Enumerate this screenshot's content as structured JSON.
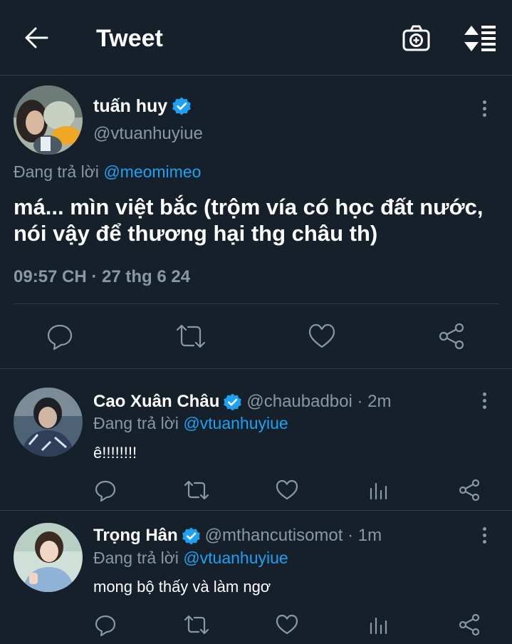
{
  "header": {
    "title": "Tweet"
  },
  "main_tweet": {
    "display_name": "tuấn huy",
    "handle": "@vtuanhuyiue",
    "replying_prefix": "Đang trả lời",
    "replying_to": "@meomimeo",
    "text": "má... mìn việt bắc (trộm vía có học đất nước, nói vậy để thương hại thg châu th)",
    "timestamp": "09:57 CH · 27 thg 6 24"
  },
  "replies": [
    {
      "display_name": "Cao Xuân Châu",
      "handle_time": "@chaubadboi · 2m",
      "replying_prefix": "Đang trả lời",
      "replying_to": "@vtuanhuyiue",
      "text": "ê!!!!!!!!"
    },
    {
      "display_name": "Trọng Hân",
      "handle_time": "@mthancutisomot · 1m",
      "replying_prefix": "Đang trả lời",
      "replying_to": "@vtuanhuyiue",
      "text": "mong bộ thấy và làm ngơ"
    }
  ],
  "colors": {
    "background": "#15202b",
    "accent": "#1da1f2",
    "secondary_text": "#8899a6",
    "divider": "#2f3b47"
  },
  "icons": [
    "back-arrow-icon",
    "camera-icon",
    "sort-icon",
    "verified-badge-icon",
    "more-options-icon",
    "reply-icon",
    "retweet-icon",
    "like-icon",
    "share-icon",
    "analytics-icon"
  ]
}
